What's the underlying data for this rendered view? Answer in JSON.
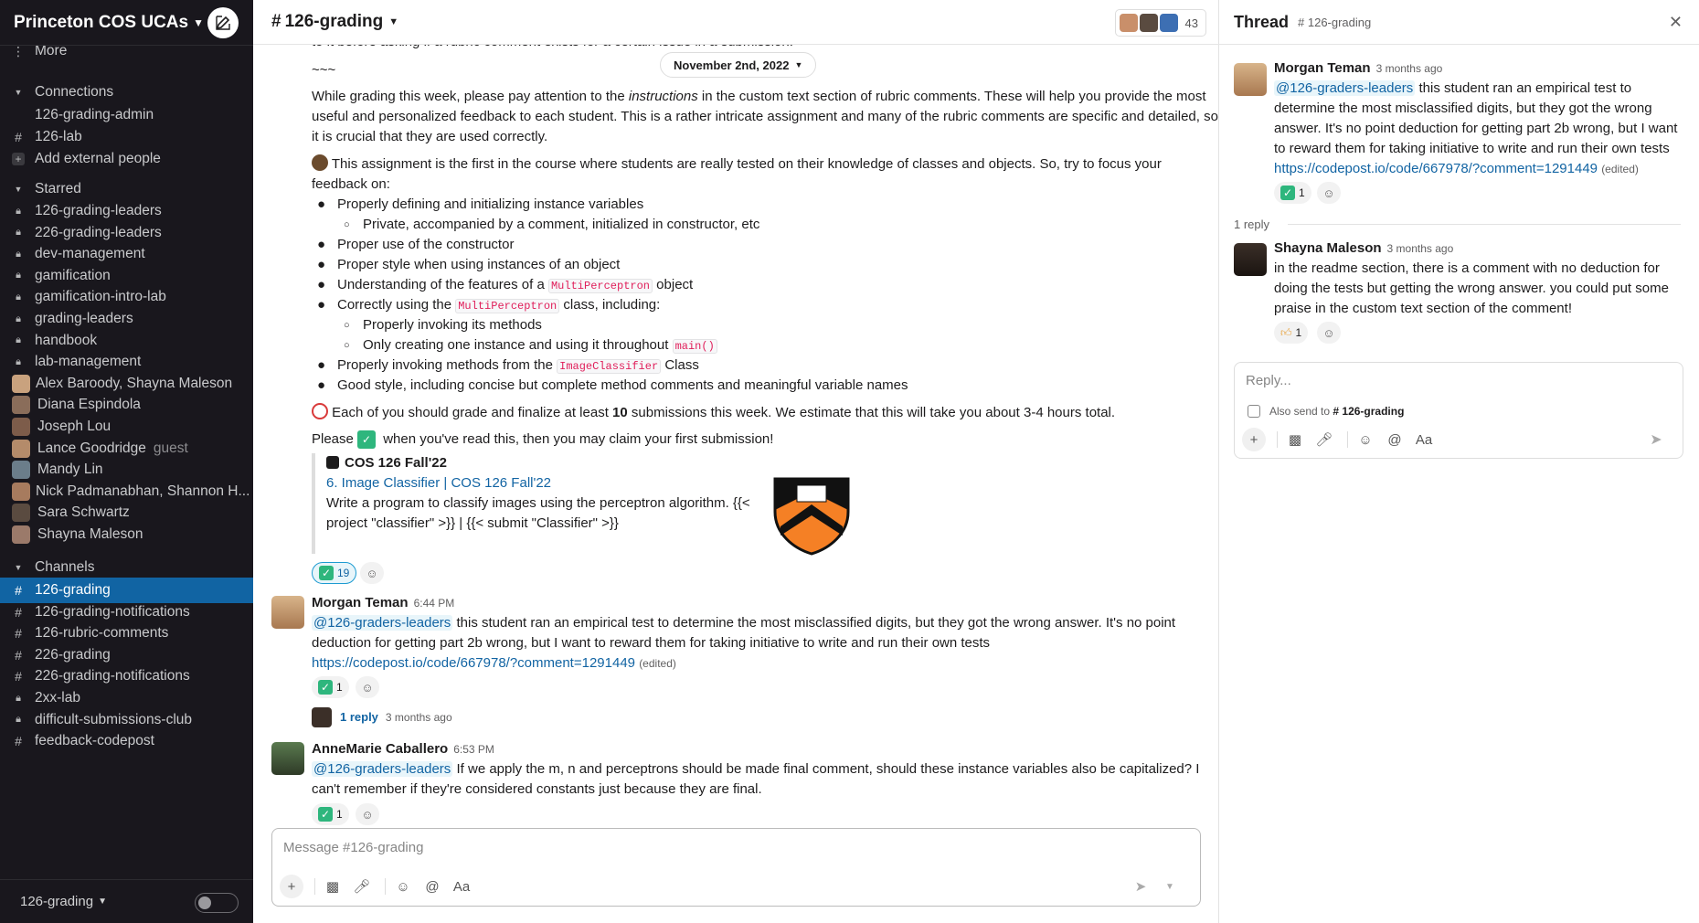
{
  "workspace": {
    "name": "Princeton COS UCAs"
  },
  "sidebar": {
    "more_label": "More",
    "connections_header": "Connections",
    "connections": [
      "126-grading-admin",
      "126-lab",
      "Add external people"
    ],
    "starred_header": "Starred",
    "starred": [
      {
        "label": "126-grading-leaders",
        "icon": "lock-icon"
      },
      {
        "label": "226-grading-leaders",
        "icon": "lock-icon"
      },
      {
        "label": "dev-management",
        "icon": "lock-icon"
      },
      {
        "label": "gamification",
        "icon": "lock-icon"
      },
      {
        "label": "gamification-intro-lab",
        "icon": "lock-icon"
      },
      {
        "label": "grading-leaders",
        "icon": "lock-icon"
      },
      {
        "label": "handbook",
        "icon": "lock-icon"
      },
      {
        "label": "lab-management",
        "icon": "lock-icon"
      },
      {
        "label": "Alex Baroody, Shayna Maleson",
        "icon": "group-dm-icon",
        "count": "2"
      },
      {
        "label": "Diana Espindola",
        "icon": "avatar"
      },
      {
        "label": "Joseph Lou",
        "icon": "avatar"
      },
      {
        "label": "Lance Goodridge",
        "icon": "avatar",
        "tag": "guest"
      },
      {
        "label": "Mandy Lin",
        "icon": "avatar"
      },
      {
        "label": "Nick Padmanabhan, Shannon H...",
        "icon": "group-dm-icon",
        "count": "2"
      },
      {
        "label": "Sara Schwartz",
        "icon": "avatar"
      },
      {
        "label": "Shayna Maleson",
        "icon": "avatar"
      }
    ],
    "channels_header": "Channels",
    "channels": [
      {
        "label": "126-grading",
        "icon": "hash-icon",
        "active": true
      },
      {
        "label": "126-grading-notifications",
        "icon": "hash-icon"
      },
      {
        "label": "126-rubric-comments",
        "icon": "hash-icon"
      },
      {
        "label": "226-grading",
        "icon": "hash-icon"
      },
      {
        "label": "226-grading-notifications",
        "icon": "hash-icon"
      },
      {
        "label": "2xx-lab",
        "icon": "lock-icon"
      },
      {
        "label": "difficult-submissions-club",
        "icon": "lock-icon"
      },
      {
        "label": "feedback-codepost",
        "icon": "hash-icon"
      }
    ],
    "footer_label": "126-grading"
  },
  "channel": {
    "title": "126-grading",
    "member_count": "43",
    "date_divider": "November 2nd, 2022",
    "cut_line": "to it before asking if a rubric comment exists for a certain issue in a submission.",
    "tildes": "~~~",
    "para1_a": "While grading this week, please pay attention to the ",
    "para1_em": "instructions",
    "para1_b": " in the custom text section of rubric comments. These will help you provide the most",
    "para1_l2": "useful and personalized feedback to each student. This is a rather intricate assignment and many of the rubric comments are specific and detailed, so",
    "para1_l3": "it is crucial that they are used correctly.",
    "para2_l1": " This assignment is the first in the course where students are really tested on their knowledge of classes and objects. So, try to focus your",
    "para2_l2": "feedback on:",
    "bullets": {
      "b1": "Properly defining and initializing instance variables",
      "b1a": "Private, accompanied by a comment, initialized in constructor, etc",
      "b2": "Proper use of the constructor",
      "b3": "Proper style when using instances of an object",
      "b4_a": "Understanding of the features of a ",
      "b4_code": "MultiPerceptron",
      "b4_b": " object",
      "b5_a": "Correctly using the ",
      "b5_code": "MultiPerceptron",
      "b5_b": " class, including:",
      "b5a": "Properly invoking its methods",
      "b5b": "Only creating one instance and using it throughout ",
      "b5b_code": "main()",
      "b6_a": "Properly invoking methods from the ",
      "b6_code": "ImageClassifier",
      "b6_b": " Class",
      "b7": "Good style, including concise but complete method comments and meaningful variable names"
    },
    "para3_a": " Each of you should grade and finalize at least ",
    "para3_bold": "10",
    "para3_b": " submissions this week. We estimate that this will take you about 3-4 hours total.",
    "para4_a": "Please ",
    "para4_b": " when you've read this, then you may claim your first submission!",
    "unfurl": {
      "site": "COS 126 Fall'22",
      "title": "6. Image Classifier | COS 126 Fall'22",
      "desc_l1": "Write a program to classify images using the perceptron algorithm. {{<",
      "desc_l2": "project \"classifier\" >}} | {{< submit \"Classifier\" >}}"
    },
    "announcement_reaction_count": "19",
    "messages": [
      {
        "author": "Morgan Teman",
        "time": "6:44 PM",
        "mention": "@126-graders-leaders",
        "text_l1": " this student ran an empirical test to determine the most misclassified digits, but they got the wrong answer. It's no point",
        "text_l2": "deduction for getting part 2b wrong, but I want to reward them for taking initiative to write and run their own tests",
        "link": "https://codepost.io/code/667978/?comment=1291449",
        "edited": "(edited)",
        "reaction_count": "1",
        "reply_count": "1 reply",
        "reply_time": "3 months ago"
      },
      {
        "author": "AnneMarie Caballero",
        "time": "6:53 PM",
        "mention": "@126-graders-leaders",
        "text_l1": " If we apply the m, n and perceptrons should be made final comment, should these instance variables also be capitalized? I",
        "text_l2": "can't remember if they're considered constants just because they are final.",
        "reaction_count": "1"
      }
    ],
    "composer_placeholder": "Message #126-grading",
    "format_label": "Aa"
  },
  "thread": {
    "title": "Thread",
    "channel": "# 126-grading",
    "parent": {
      "author": "Morgan Teman",
      "time": "3 months ago",
      "mention": "@126-graders-leaders",
      "l1": " this student ran an empirical test to",
      "l2": "determine the most misclassified digits, but they got the wrong",
      "l3": "answer. It's no point deduction for getting part 2b wrong, but I want",
      "l4": "to reward them for taking initiative to write and run their own tests",
      "link": "https://codepost.io/code/667978/?comment=1291449",
      "edited": "(edited)",
      "reaction_count": "1"
    },
    "reply_count_label": "1 reply",
    "reply": {
      "author": "Shayna Maleson",
      "time": "3 months ago",
      "l1": "in the readme section, there is a comment with no deduction for",
      "l2": "doing the tests but getting the wrong answer. you could put some",
      "l3": "praise in the custom text section of the comment!",
      "reaction_count": "1"
    },
    "reply_placeholder": "Reply...",
    "also_send_label": "Also send to",
    "also_send_channel": "# 126-grading",
    "format_label": "Aa"
  },
  "colors": {
    "sidebar_bg": "#19171d",
    "active": "#1164a3",
    "link": "#1264a3",
    "mention_bg": "#e8f5fa",
    "check": "#2eb67d"
  }
}
